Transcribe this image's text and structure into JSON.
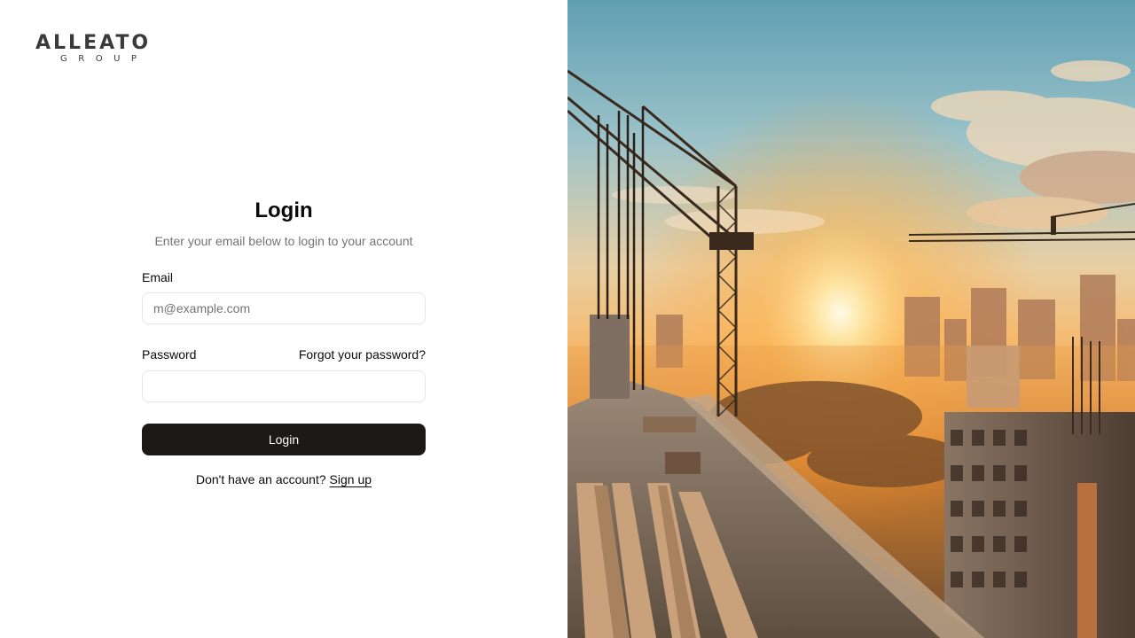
{
  "brand": {
    "name": "ALLEATO",
    "tagline": "GROUP"
  },
  "login": {
    "title": "Login",
    "subtitle": "Enter your email below to login to your account",
    "email_label": "Email",
    "email_placeholder": "m@example.com",
    "email_value": "",
    "password_label": "Password",
    "password_value": "",
    "forgot_link": "Forgot your password?",
    "submit_label": "Login",
    "signup_prompt": "Don't have an account?",
    "signup_link": "Sign up"
  },
  "colors": {
    "primary_button": "#1c1917",
    "muted_text": "#737373",
    "border": "#e5e5e5",
    "logo_accent": "#e8731a"
  }
}
